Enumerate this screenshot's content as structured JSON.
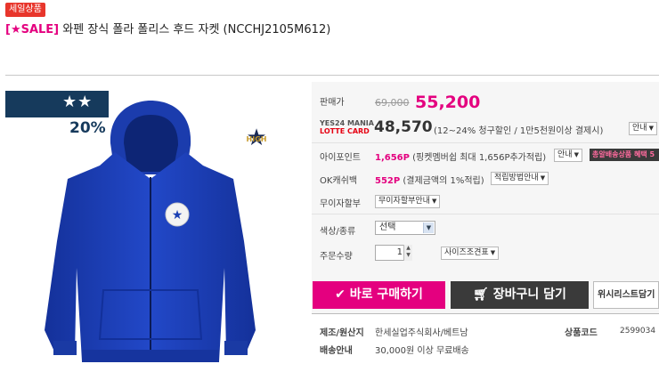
{
  "badge": {
    "text": "세일상품"
  },
  "title": {
    "prefix": "[★SALE]",
    "text": "와펜 장식 폴라 폴리스 후드 자켓 (NCCHJ2105M612)"
  },
  "product_image": {
    "discount_stars": "★★",
    "discount_pct": "20%",
    "alt": "blue hooded zip jacket"
  },
  "info": {
    "price": {
      "label": "판매가",
      "original": "69,000",
      "sale": "55,200"
    },
    "card": {
      "brand_line1": "YES24 MANIA",
      "brand_line2": "LOTTE CARD",
      "price": "48,570",
      "note": "(12~24% 청구할인 / 1만5천원이상 결제시)",
      "guide": "안내"
    },
    "ipoint": {
      "label": "아이포인트",
      "value": "1,656P",
      "note": "(핑켓멤버쉽 최대 1,656P추가적립)",
      "guide": "안내",
      "badge": "총알배송상품 혜택 5"
    },
    "okcash": {
      "label": "OK캐쉬백",
      "value": "552P",
      "note": "(결제금액의 1%적립)",
      "method": "적립방법안내"
    },
    "installment": {
      "label": "무이자할부",
      "guide": "무이자할부안내"
    },
    "color": {
      "label": "색상/종류",
      "selected": "선택"
    },
    "quantity": {
      "label": "주문수량",
      "value": "1",
      "size_chart": "사이즈조견표"
    },
    "buttons": {
      "buy": "바로 구매하기",
      "cart": "장바구니 담기",
      "wishlist": "위시리스트담기"
    },
    "maker": {
      "label": "제조/원산지",
      "value": "한세실업주식회사/베트남"
    },
    "code": {
      "label": "상품코드",
      "value": "2599034"
    },
    "shipping": {
      "label": "배송안내",
      "value": "30,000원 이상 무료배송"
    }
  },
  "colors": {
    "accent": "#e4007f",
    "navy": "#163a5c",
    "dark": "#3a3a3a",
    "jacket": "#1a3fb3"
  }
}
